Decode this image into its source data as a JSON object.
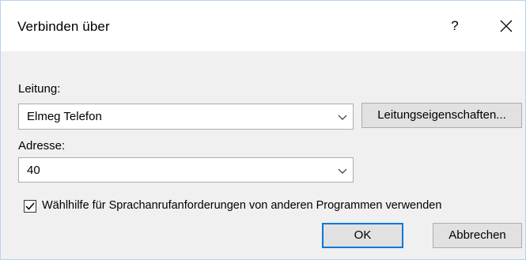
{
  "window": {
    "title": "Verbinden über",
    "help_label": "?"
  },
  "form": {
    "line_label": "Leitung:",
    "line_value": "Elmeg Telefon",
    "line_properties_button": "Leitungseigenschaften...",
    "address_label": "Adresse:",
    "address_value": "40",
    "dialing_helper_label": "Wählhilfe für Sprachanrufanforderungen von anderen Programmen verwenden",
    "dialing_helper_checked": true
  },
  "buttons": {
    "ok": "OK",
    "cancel": "Abbrechen"
  },
  "colors": {
    "accent": "#0078d7",
    "dialog_bg": "#f0f0f0",
    "button_bg": "#e1e1e1"
  },
  "icons": [
    "close-icon",
    "chevron-down-icon",
    "checkmark-icon"
  ]
}
